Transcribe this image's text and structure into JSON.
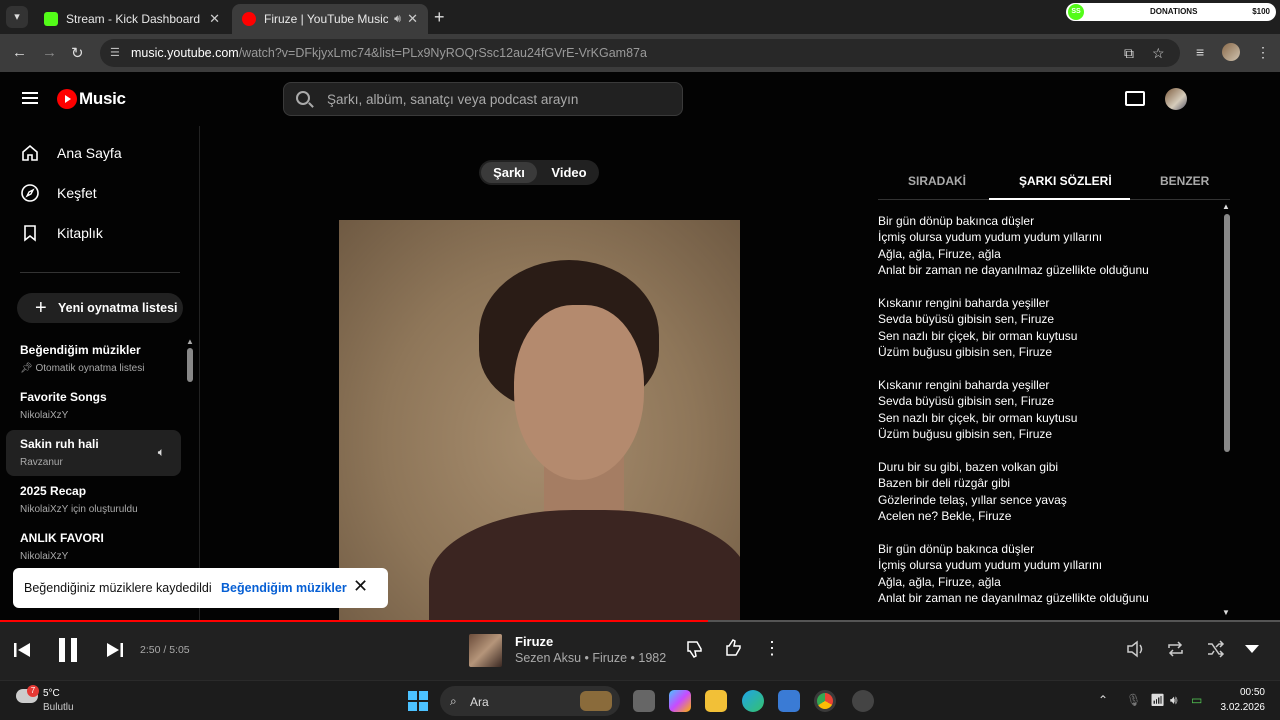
{
  "browser": {
    "tabs": [
      {
        "title": "Stream - Kick Dashboard",
        "active": false
      },
      {
        "title": "Firuze | YouTube Music",
        "active": true
      }
    ],
    "url_host": "music.youtube.com",
    "url_path": "/watch?v=DFkjyxLmc74&list=PLx9NyROQrSsc12au24fGVrE-VrKGam87a",
    "donation_label": "DONATIONS",
    "donation_amount": "$100"
  },
  "header": {
    "logo_text": "Music",
    "search_placeholder": "Şarkı, albüm, sanatçı veya podcast arayın"
  },
  "sidebar": {
    "nav": [
      {
        "label": "Ana Sayfa",
        "icon": "home-icon"
      },
      {
        "label": "Keşfet",
        "icon": "compass-icon"
      },
      {
        "label": "Kitaplık",
        "icon": "library-icon"
      }
    ],
    "new_playlist": "Yeni oynatma listesi",
    "playlists": [
      {
        "title": "Beğendiğim müzikler",
        "subtitle": "Otomatik oynatma listesi",
        "pinned": true
      },
      {
        "title": "Favorite Songs",
        "subtitle": "NikolaiXzY"
      },
      {
        "title": "Sakin ruh hali",
        "subtitle": "Ravzanur",
        "playing": true
      },
      {
        "title": "2025 Recap",
        "subtitle": "NikolaiXzY için oluşturuldu"
      },
      {
        "title": "ANLIK FAVORI",
        "subtitle": "NikolaiXzY"
      }
    ]
  },
  "main": {
    "toggle": {
      "song": "Şarkı",
      "video": "Video"
    }
  },
  "right_panel": {
    "tabs": [
      "SIRADAKİ",
      "ŞARKI SÖZLERİ",
      "BENZER"
    ],
    "active_tab": 1,
    "lyrics": [
      [
        "Bir gün dönüp bakınca düşler",
        "İçmiş olursa yudum yudum yudum yıllarını",
        "Ağla, ağla, Firuze, ağla",
        "Anlat bir zaman ne dayanılmaz güzellikte olduğunu"
      ],
      [
        "Kıskanır rengini baharda yeşiller",
        "Sevda büyüsü gibisin sen, Firuze",
        "Sen nazlı bir çiçek, bir orman kuytusu",
        "Üzüm buğusu gibisin sen, Firuze"
      ],
      [
        "Kıskanır rengini baharda yeşiller",
        "Sevda büyüsü gibisin sen, Firuze",
        "Sen nazlı bir çiçek, bir orman kuytusu",
        "Üzüm buğusu gibisin sen, Firuze"
      ],
      [
        "Duru bir su gibi, bazen volkan gibi",
        "Bazen bir deli rüzgâr gibi",
        "Gözlerinde telaş, yıllar sence yavaş",
        "Acelen ne? Bekle, Firuze"
      ],
      [
        "Bir gün dönüp bakınca düşler",
        "İçmiş olursa yudum yudum yudum yıllarını",
        "Ağla, ağla, Firuze, ağla",
        "Anlat bir zaman ne dayanılmaz güzellikte olduğunu"
      ]
    ]
  },
  "toast": {
    "message": "Beğendiğiniz müziklere kaydedildi",
    "action": "Beğendiğim müzikler"
  },
  "player": {
    "time": "2:50 / 5:05",
    "progress": 0.553,
    "title": "Firuze",
    "subtitle": "Sezen Aksu • Firuze • 1982"
  },
  "taskbar": {
    "weather_badge": "7",
    "temperature": "5°C",
    "condition": "Bulutlu",
    "search_label": "Ara",
    "time": "00:50",
    "date": "3.02.2026"
  }
}
